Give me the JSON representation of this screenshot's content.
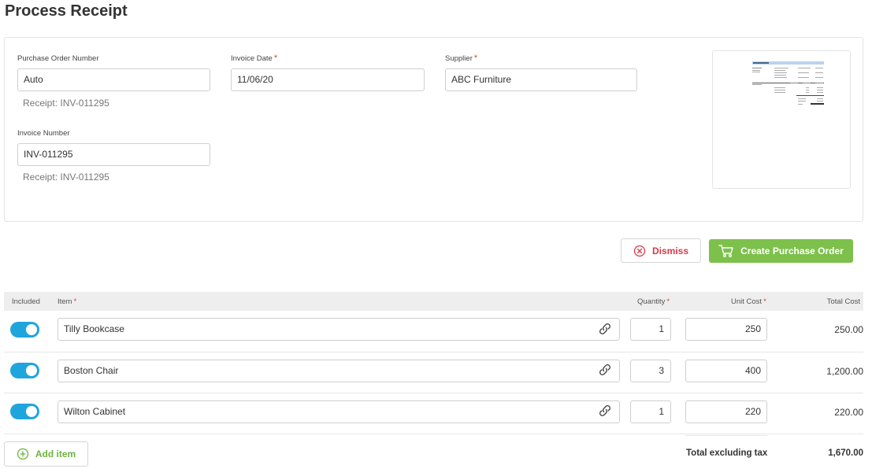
{
  "page": {
    "title": "Process Receipt"
  },
  "form": {
    "po_number": {
      "label": "Purchase Order Number",
      "value": "Auto",
      "hint": "Receipt: INV-011295"
    },
    "invoice_date": {
      "label": "Invoice Date",
      "required_mark": "*",
      "value": "11/06/20"
    },
    "supplier": {
      "label": "Supplier",
      "required_mark": "*",
      "value": "ABC Furniture"
    },
    "invoice_number": {
      "label": "Invoice Number",
      "value": "INV-011295",
      "hint": "Receipt: INV-011295"
    }
  },
  "actions": {
    "dismiss_label": "Dismiss",
    "create_label": "Create Purchase Order",
    "add_item_label": "Add item"
  },
  "table": {
    "headers": {
      "included": "Included",
      "item": "Item",
      "quantity": "Quantity",
      "unit_cost": "Unit Cost",
      "total_cost": "Total Cost",
      "required_mark": "*"
    },
    "rows": [
      {
        "included": true,
        "item": "Tilly Bookcase",
        "quantity": "1",
        "unit_cost": "250",
        "total_cost": "250.00"
      },
      {
        "included": true,
        "item": "Boston Chair",
        "quantity": "3",
        "unit_cost": "400",
        "total_cost": "1,200.00"
      },
      {
        "included": true,
        "item": "Wilton Cabinet",
        "quantity": "1",
        "unit_cost": "220",
        "total_cost": "220.00"
      }
    ],
    "total_label": "Total excluding tax",
    "total_value": "1,670.00"
  },
  "colors": {
    "accent_green": "#7dc04b",
    "toggle_blue": "#1fa5dd",
    "danger_red": "#d93a4a"
  },
  "icons": {
    "dismiss": "close-circle-icon",
    "create": "shopping-cart-icon",
    "add": "plus-circle-icon",
    "link": "link-icon"
  }
}
